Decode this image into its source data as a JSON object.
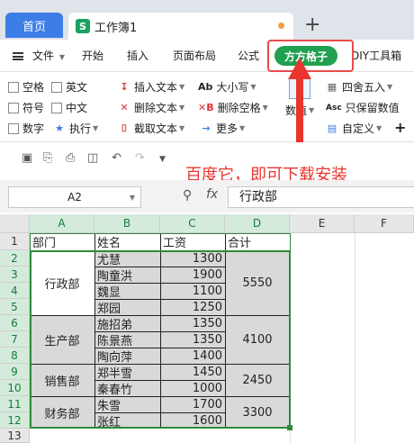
{
  "tabs": {
    "home": "首页",
    "workbook": "工作簿1",
    "new_tab": "+"
  },
  "menu": {
    "file": "文件",
    "start": "开始",
    "insert": "插入",
    "layout": "页面布局",
    "formula": "公式",
    "ffgz": "方方格子",
    "diy": "DIY工具箱"
  },
  "ribbon": {
    "cb_space": "空格",
    "cb_english": "英文",
    "cb_symbol": "符号",
    "cb_chinese": "中文",
    "cb_number": "数字",
    "execute": "执行",
    "insert_text": "插入文本",
    "delete_text": "删除文本",
    "extract_text": "截取文本",
    "case": "大小写",
    "delete_space": "删除空格",
    "more": "更多",
    "value": "数值",
    "round": "四舍五入",
    "keep_value": "只保留数值",
    "custom": "自定义"
  },
  "annotation": "百度它，即可下载安装",
  "formula_bar": {
    "name_box": "A2",
    "fx": "fx",
    "content": "行政部"
  },
  "columns": [
    "A",
    "B",
    "C",
    "D",
    "E",
    "F"
  ],
  "rows": [
    "1",
    "2",
    "3",
    "4",
    "5",
    "6",
    "7",
    "8",
    "9",
    "10",
    "11",
    "12",
    "13"
  ],
  "headers": {
    "a": "部门",
    "b": "姓名",
    "c": "工资",
    "d": "合计"
  },
  "departments": [
    {
      "name": "行政部",
      "total": "5550"
    },
    {
      "name": "生产部",
      "total": "4100"
    },
    {
      "name": "销售部",
      "total": "2450"
    },
    {
      "name": "财务部",
      "total": "3300"
    }
  ],
  "employees": [
    {
      "name": "尤慧",
      "salary": "1300"
    },
    {
      "name": "陶童洪",
      "salary": "1900"
    },
    {
      "name": "魏显",
      "salary": "1100"
    },
    {
      "name": "郑园",
      "salary": "1250"
    },
    {
      "name": "施招弟",
      "salary": "1350"
    },
    {
      "name": "陈景燕",
      "salary": "1350"
    },
    {
      "name": "陶向萍",
      "salary": "1400"
    },
    {
      "name": "郑半雪",
      "salary": "1450"
    },
    {
      "name": "秦春竹",
      "salary": "1000"
    },
    {
      "name": "朱雪",
      "salary": "1700"
    },
    {
      "name": "张红",
      "salary": "1600"
    }
  ]
}
